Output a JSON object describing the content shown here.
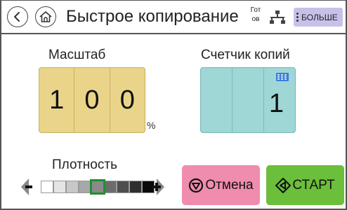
{
  "header": {
    "title": "Быстрое копирование",
    "status_line1": "Гот",
    "status_line2": "ов",
    "more_label": "БОЛЬШЕ"
  },
  "scale": {
    "label": "Масштаб",
    "digits": [
      "1",
      "0",
      "0"
    ],
    "unit": "%"
  },
  "counter": {
    "label": "Счетчик копий",
    "value": "1"
  },
  "density": {
    "label": "Плотность",
    "selected_level": 5,
    "levels": 9,
    "swatch_colors": [
      "#ffffff",
      "#e4e4e4",
      "#c8c8c8",
      "#a8a8a8",
      "#8a8a8a",
      "#6c6c6c",
      "#4e4e4e",
      "#2e2e2e",
      "#0a0a0a"
    ]
  },
  "actions": {
    "cancel_label": "Отмена",
    "start_label": "СТАРТ"
  },
  "icons": {
    "back": "back-arrow-icon",
    "home": "home-icon",
    "network": "network-icon",
    "more": "more-dots-icon",
    "keypad": "keypad-icon",
    "cancel": "stop-icon",
    "start": "start-icon"
  },
  "colors": {
    "scale_bg": "#e9d48a",
    "counter_bg": "#9fd6d6",
    "cancel_bg": "#f08cad",
    "start_bg": "#6bbf3a",
    "more_bg": "#c7c1ea",
    "selected_outline": "#1f8f2f"
  }
}
